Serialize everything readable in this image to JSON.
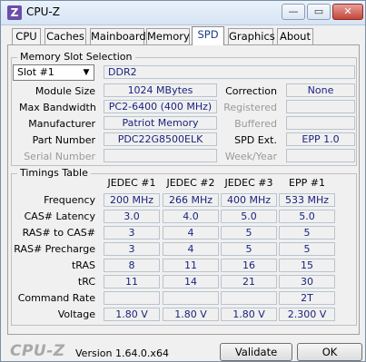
{
  "window": {
    "title": "CPU-Z",
    "icon_letter": "Z",
    "min_glyph": "—",
    "max_glyph": "▭",
    "close_glyph": "✕"
  },
  "tabs": [
    "CPU",
    "Caches",
    "Mainboard",
    "Memory",
    "SPD",
    "Graphics",
    "About"
  ],
  "active_tab": "SPD",
  "slot_selection": {
    "title": "Memory Slot Selection",
    "slot": "Slot #1",
    "type": "DDR2",
    "module_size_label": "Module Size",
    "module_size": "1024 MBytes",
    "max_bandwidth_label": "Max Bandwidth",
    "max_bandwidth": "PC2-6400 (400 MHz)",
    "manufacturer_label": "Manufacturer",
    "manufacturer": "Patriot Memory",
    "part_number_label": "Part Number",
    "part_number": "PDC22G8500ELK",
    "serial_number_label": "Serial Number",
    "serial_number": "",
    "correction_label": "Correction",
    "correction": "None",
    "registered_label": "Registered",
    "registered": "",
    "buffered_label": "Buffered",
    "buffered": "",
    "spd_ext_label": "SPD Ext.",
    "spd_ext": "EPP 1.0",
    "week_year_label": "Week/Year",
    "week_year": ""
  },
  "timings": {
    "title": "Timings Table",
    "columns": [
      "JEDEC #1",
      "JEDEC #2",
      "JEDEC #3",
      "EPP #1"
    ],
    "rows": [
      {
        "label": "Frequency",
        "values": [
          "200 MHz",
          "266 MHz",
          "400 MHz",
          "533 MHz"
        ]
      },
      {
        "label": "CAS# Latency",
        "values": [
          "3.0",
          "4.0",
          "5.0",
          "5.0"
        ]
      },
      {
        "label": "RAS# to CAS#",
        "values": [
          "3",
          "4",
          "5",
          "5"
        ]
      },
      {
        "label": "RAS# Precharge",
        "values": [
          "3",
          "4",
          "5",
          "5"
        ]
      },
      {
        "label": "tRAS",
        "values": [
          "8",
          "11",
          "16",
          "15"
        ]
      },
      {
        "label": "tRC",
        "values": [
          "11",
          "14",
          "21",
          "30"
        ]
      },
      {
        "label": "Command Rate",
        "values": [
          "",
          "",
          "",
          "2T"
        ]
      },
      {
        "label": "Voltage",
        "values": [
          "1.80 V",
          "1.80 V",
          "1.80 V",
          "2.300 V"
        ]
      }
    ]
  },
  "footer": {
    "logo": "CPU-Z",
    "version": "Version 1.64.0.x64",
    "validate_label": "Validate",
    "ok_label": "OK"
  }
}
